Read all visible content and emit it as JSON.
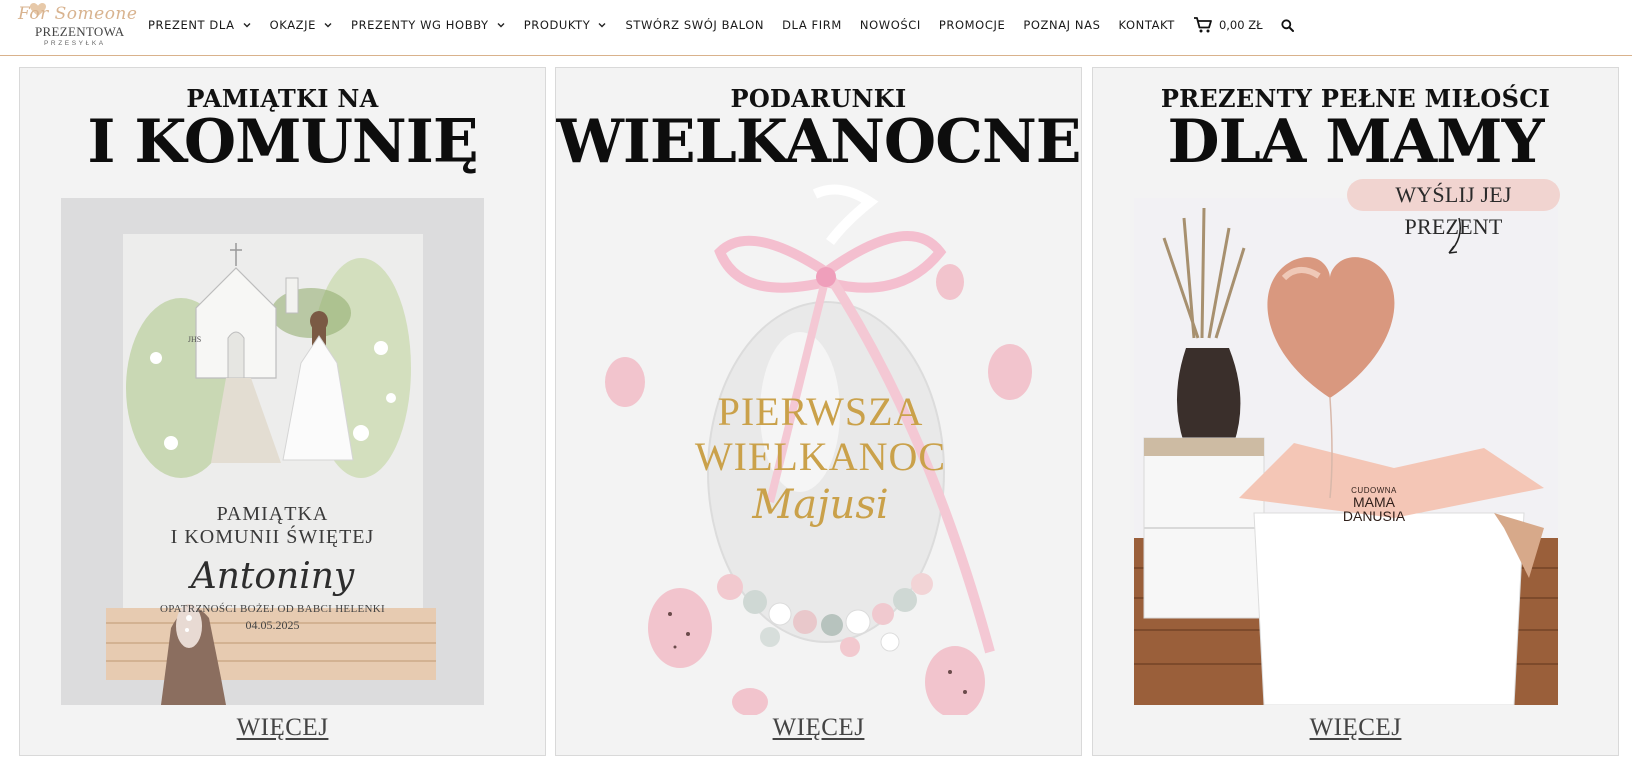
{
  "brand": {
    "script": "For Someone",
    "name": "PREZENTOWA",
    "sub": "PRZESYŁKA"
  },
  "nav": {
    "items": [
      {
        "label": "PREZENT DLA",
        "dropdown": true
      },
      {
        "label": "OKAZJE",
        "dropdown": true
      },
      {
        "label": "PREZENTY WG HOBBY",
        "dropdown": true
      },
      {
        "label": "PRODUKTY",
        "dropdown": true
      },
      {
        "label": "STWÓRZ SWÓJ BALON",
        "dropdown": false
      },
      {
        "label": "DLA FIRM",
        "dropdown": false
      },
      {
        "label": "NOWOŚCI",
        "dropdown": false
      },
      {
        "label": "PROMOCJE",
        "dropdown": false
      },
      {
        "label": "POZNAJ NAS",
        "dropdown": false
      },
      {
        "label": "KONTAKT",
        "dropdown": false
      }
    ],
    "cart_total": "0,00 ZŁ",
    "icons": {
      "dropdown": "chevron-down-icon",
      "cart": "cart-icon",
      "search": "search-icon"
    }
  },
  "cards": [
    {
      "line1": "PAMIĄTKI NA",
      "line2": "I KOMUNIĘ",
      "photo_text": {
        "heading_a": "PAMIĄTKA",
        "heading_b": "I KOMUNII ŚWIĘTEJ",
        "name": "Antoniny",
        "dedication": "OPATRZNOŚCI BOŻEJ OD BABCI HELENKI",
        "date": "04.05.2025",
        "chapel_sign": "JHS"
      },
      "more": "WIĘCEJ"
    },
    {
      "line1": "PODARUNKI",
      "line2": "WIELKANOCNE",
      "photo_text": {
        "line_a": "PIERWSZA",
        "line_b": "WIELKANOC",
        "name": "Majusi"
      },
      "more": "WIĘCEJ"
    },
    {
      "line1": "PREZENTY PEŁNE MIŁOŚCI",
      "line2": "DLA MAMY",
      "photo_text": {
        "badge": "WYŚLIJ JEJ PREZENT",
        "balloon_small": "CUDOWNA",
        "balloon_a": "MAMA",
        "balloon_b": "DANUSIA"
      },
      "more": "WIĘCEJ"
    }
  ],
  "colors": {
    "accent": "#d9b28c",
    "card_bg": "#f3f3f3",
    "gold": "#caa14a",
    "pink": "#f1d4d0"
  }
}
